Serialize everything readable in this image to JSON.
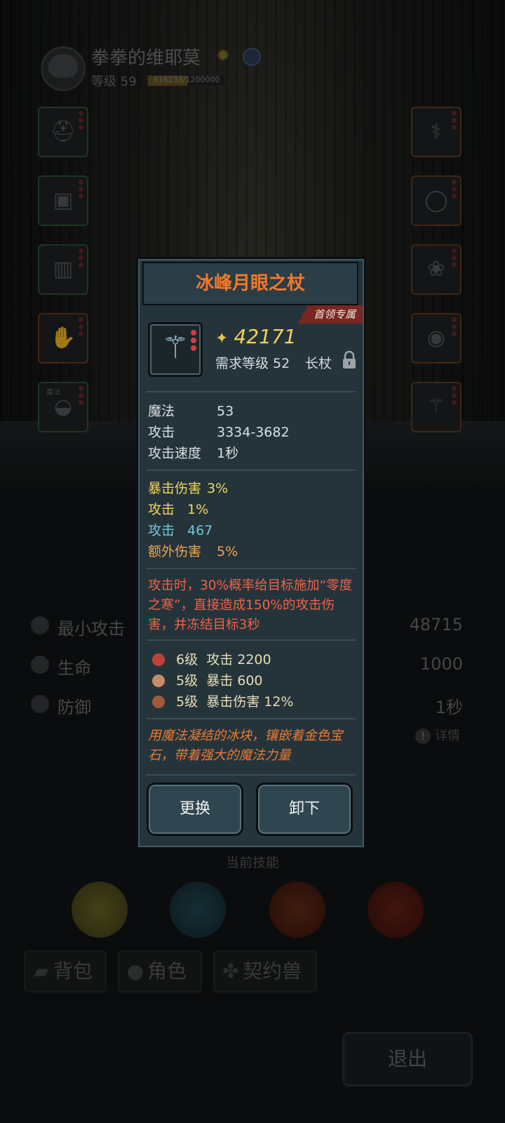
{
  "player": {
    "name": "拳拳的维耶莫",
    "level_label": "等级 59",
    "exp_text": "616233/1200000",
    "exp_fraction": 0.51
  },
  "equipment_slots": {
    "left": [
      "helmet-icon",
      "armor-icon",
      "boots-icon",
      "gloves-icon",
      "cloak-icon"
    ],
    "right": [
      "necklace-icon",
      "ring-icon",
      "amulet-icon",
      "bracelet-icon",
      "staff-icon"
    ],
    "cloak_tag": "魔法"
  },
  "stats": [
    {
      "label": "最小攻击",
      "value": "48715"
    },
    {
      "label": "生命",
      "value": "1000"
    },
    {
      "label": "防御",
      "value": "1秒"
    }
  ],
  "detail_label": "详情",
  "skills_title": "当前技能",
  "tabs": [
    {
      "label": "背包",
      "icon": "bag-icon"
    },
    {
      "label": "角色",
      "icon": "character-icon"
    },
    {
      "label": "契约兽",
      "icon": "paw-icon"
    }
  ],
  "exit_label": "退出",
  "popup": {
    "title": "冰峰月眼之杖",
    "boss_tag": "首领专属",
    "power": "42171",
    "req_level": "需求等级 52",
    "item_type": "长杖",
    "base_stats": [
      {
        "label": "魔法",
        "value": "53"
      },
      {
        "label": "攻击",
        "value": "3334-3682"
      },
      {
        "label": "攻击速度",
        "value": "1秒"
      }
    ],
    "bonus_stats": [
      {
        "label": "暴击伤害",
        "value": "3%",
        "color": "#f2d45e"
      },
      {
        "label": "攻击",
        "value": "1%",
        "color": "#f2d45e"
      },
      {
        "label": "攻击",
        "value": "467",
        "color": "#6fc8d6"
      },
      {
        "label": "额外伤害",
        "value": "5%",
        "color": "#f0a34a"
      }
    ],
    "effect": "攻击时，30%概率给目标施加“零度之寒”，直接造成150%的攻击伤害，并冻结目标3秒",
    "gems": [
      {
        "level": "6级",
        "stat": "攻击 2200",
        "color": "#c0423a"
      },
      {
        "level": "5级",
        "stat": "暴击 600",
        "color": "#c98a6a"
      },
      {
        "level": "5级",
        "stat": "暴击伤害 12%",
        "color": "#a05a3a"
      }
    ],
    "flavor": "用魔法凝结的冰块，镶嵌着金色宝石，带着强大的魔法力量",
    "replace_label": "更换",
    "unequip_label": "卸下"
  }
}
